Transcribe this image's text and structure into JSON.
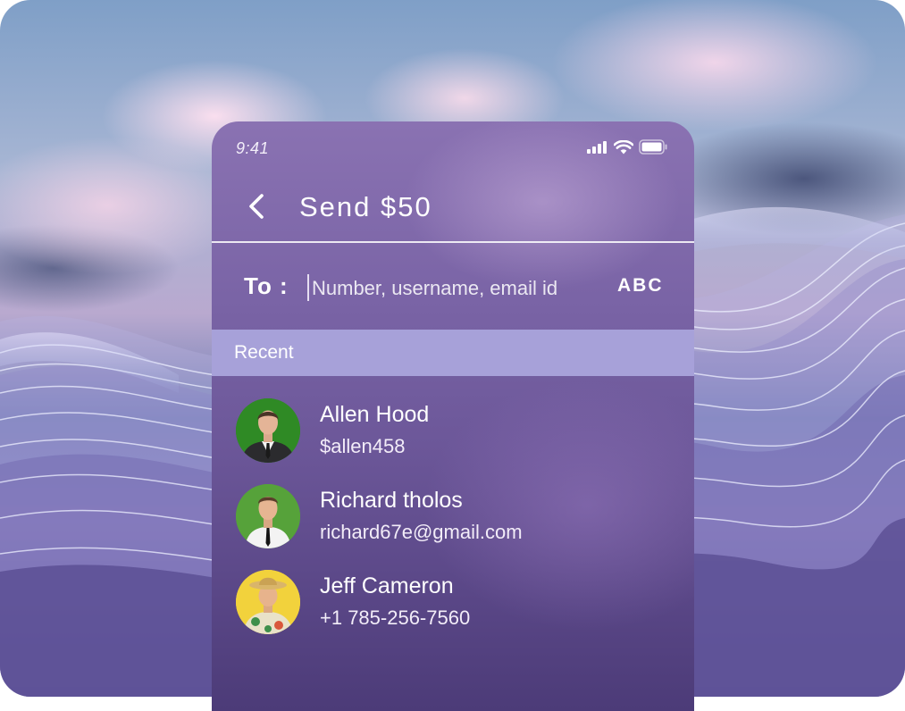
{
  "status": {
    "time": "9:41"
  },
  "header": {
    "title": "Send $50",
    "back_icon": "chevron-left-icon"
  },
  "to": {
    "label": "To :",
    "placeholder": "Number, username, email id",
    "keyboard_toggle": "ABC"
  },
  "recent": {
    "label": "Recent",
    "contacts": [
      {
        "name": "Allen Hood",
        "handle": "$allen458",
        "avatar_bg": "#2f8a25"
      },
      {
        "name": "Richard tholos",
        "handle": "richard67e@gmail.com",
        "avatar_bg": "#56a23a"
      },
      {
        "name": "Jeff Cameron",
        "handle": "+1 785-256-7560",
        "avatar_bg": "#f2d23c"
      }
    ]
  },
  "colors": {
    "recent_bar": "#a7a1d9",
    "panel_top": "#8a72b2",
    "panel_bottom": "#4c3b78"
  }
}
